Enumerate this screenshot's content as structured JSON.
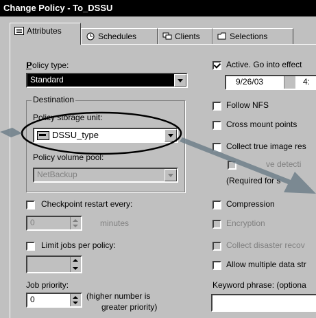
{
  "window": {
    "title": "Change Policy - To_DSSU"
  },
  "tabs": [
    {
      "label": "Attributes",
      "icon": "list-icon"
    },
    {
      "label": "Schedules",
      "icon": "schedule-clock-icon"
    },
    {
      "label": "Clients",
      "icon": "clients-computer-icon"
    },
    {
      "label": "Selections",
      "icon": "folder-icon"
    }
  ],
  "left": {
    "policy_type_label": "Policy type:",
    "policy_type_value": "Standard",
    "destination_label": "Destination",
    "storage_unit_label": "Policy storage unit:",
    "storage_unit_value": "DSSU_type",
    "volume_pool_label": "Policy volume pool:",
    "volume_pool_value": "NetBackup",
    "checkpoint_label": "Checkpoint restart every:",
    "checkpoint_value": "0",
    "checkpoint_units": "minutes",
    "limit_jobs_label": "Limit jobs per policy:",
    "job_priority_label": "Job priority:",
    "job_priority_value": "0",
    "job_priority_hint1": "(higher number is",
    "job_priority_hint2": "greater priority)"
  },
  "right": {
    "active_label": "Active. Go into effect",
    "active_date": "9/26/03",
    "active_time": "4:",
    "follow_nfs_label": "Follow NFS",
    "cross_mount_label": "Cross mount points",
    "collect_true_image_label": "Collect true image res",
    "move_detection_label": "ve detecti",
    "required_for_label": "(Required for s",
    "compression_label": "Compression",
    "encryption_label": "Encryption",
    "collect_disaster_label": "Collect disaster recov",
    "allow_multiple_label": "Allow multiple data str",
    "keyword_label": "Keyword phrase: (optiona"
  },
  "colors": {
    "window_bg": "#c0c0c0",
    "titlebar": "#000000",
    "arrow": "#6f7f8a"
  }
}
